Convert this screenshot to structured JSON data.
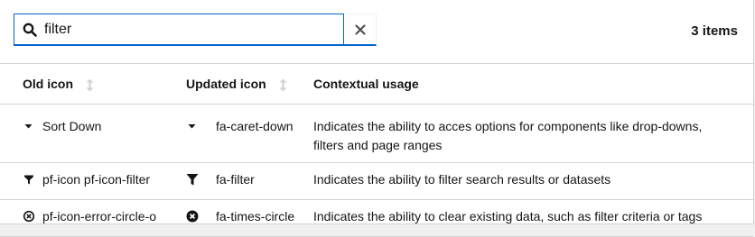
{
  "search": {
    "value": "filter",
    "placeholder": ""
  },
  "toolbar": {
    "count": "3 items"
  },
  "table": {
    "headers": {
      "old_icon": "Old icon",
      "updated_icon": "Updated icon",
      "usage": "Contextual usage"
    },
    "rows": [
      {
        "old_icon": "caret-down-icon",
        "old_name": "Sort Down",
        "new_icon": "caret-down-icon",
        "new_name": "fa-caret-down",
        "usage": "Indicates the ability to acces options for components like drop-downs, filters and page ranges"
      },
      {
        "old_icon": "filter-icon",
        "old_name": "pf-icon pf-icon-filter",
        "new_icon": "filter-icon",
        "new_name": "fa-filter",
        "usage": "Indicates the ability to filter search results or datasets"
      },
      {
        "old_icon": "error-circle-outline-icon",
        "old_name": "pf-icon-error-circle-o",
        "new_icon": "times-circle-icon",
        "new_name": "fa-times-circle",
        "usage": "Indicates the ability to clear existing data, such as filter criteria or tags"
      }
    ]
  }
}
